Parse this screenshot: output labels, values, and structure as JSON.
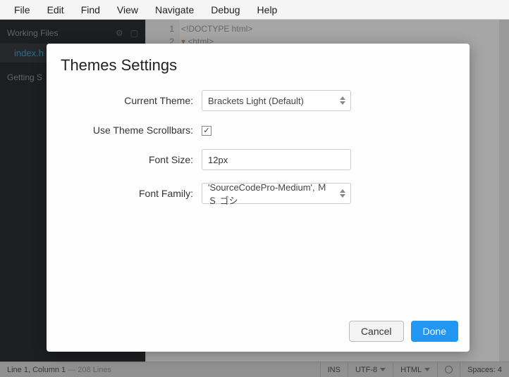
{
  "menubar": [
    "File",
    "Edit",
    "Find",
    "View",
    "Navigate",
    "Debug",
    "Help"
  ],
  "sidebar": {
    "working_files_label": "Working Files",
    "file_name": "index.h",
    "getting_started": "Getting S"
  },
  "editor": {
    "lines": [
      "1",
      "2"
    ],
    "code1": "<!DOCTYPE html>",
    "code2_arrow": "▾",
    "code2": "<html>"
  },
  "modal": {
    "title": "Themes Settings",
    "labels": {
      "current_theme": "Current Theme:",
      "scrollbars": "Use Theme Scrollbars:",
      "font_size": "Font Size:",
      "font_family": "Font Family:"
    },
    "values": {
      "current_theme": "Brackets Light (Default)",
      "scrollbars_checked": "✓",
      "font_size": "12px",
      "font_family": "'SourceCodePro-Medium', ＭＳ ゴシ"
    },
    "buttons": {
      "cancel": "Cancel",
      "done": "Done"
    }
  },
  "statusbar": {
    "pos": "Line 1, Column 1",
    "lines": " — 208 Lines",
    "ins": "INS",
    "enc": "UTF-8",
    "lang": "HTML",
    "spaces": "Spaces: 4"
  }
}
